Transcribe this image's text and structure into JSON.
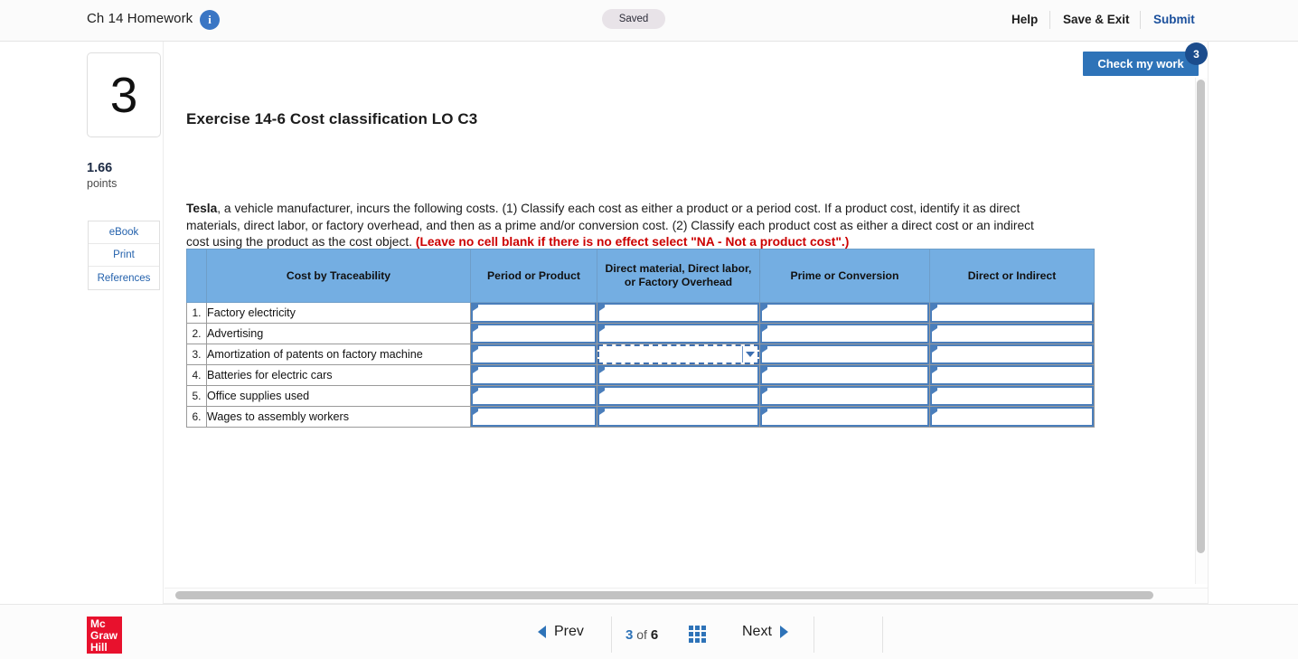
{
  "topbar": {
    "assignment_title": "Ch 14 Homework",
    "info_icon": "info-icon",
    "saved_status": "Saved",
    "help_label": "Help",
    "save_exit_label": "Save & Exit",
    "submit_label": "Submit"
  },
  "check_my_work": {
    "label": "Check my work",
    "badge_count": "3"
  },
  "rail": {
    "question_number": "3",
    "points_value": "1.66",
    "points_label": "points",
    "links": [
      {
        "label": "eBook"
      },
      {
        "label": "Print"
      },
      {
        "label": "References"
      }
    ]
  },
  "exercise": {
    "title": "Exercise 14-6 Cost classification LO C3",
    "prompt_bold_lead": "Tesla",
    "prompt_body": ", a vehicle manufacturer, incurs the following costs. (1) Classify each cost as either a product or a period cost. If a product cost, identify it as direct materials, direct labor, or factory overhead, and then as a prime and/or conversion cost. (2) Classify each product cost as either a direct cost or an indirect cost using the product as the cost object. ",
    "prompt_red": "(Leave no cell blank if there is no effect select \"NA - Not a product cost\".)"
  },
  "table": {
    "headers": [
      "Cost by Traceability",
      "Period or Product",
      "Direct material, Direct labor, or Factory Overhead",
      "Prime or Conversion",
      "Direct or Indirect"
    ],
    "rows": [
      {
        "num": "1.",
        "cost": "Factory electricity",
        "period_or_product": "",
        "dm_dl_fo": "",
        "prime_or_conversion": "",
        "direct_or_indirect": ""
      },
      {
        "num": "2.",
        "cost": "Advertising",
        "period_or_product": "",
        "dm_dl_fo": "",
        "prime_or_conversion": "",
        "direct_or_indirect": ""
      },
      {
        "num": "3.",
        "cost": "Amortization of patents on factory machine",
        "period_or_product": "",
        "dm_dl_fo": "",
        "prime_or_conversion": "",
        "direct_or_indirect": ""
      },
      {
        "num": "4.",
        "cost": "Batteries for electric cars",
        "period_or_product": "",
        "dm_dl_fo": "",
        "prime_or_conversion": "",
        "direct_or_indirect": ""
      },
      {
        "num": "5.",
        "cost": "Office supplies used",
        "period_or_product": "",
        "dm_dl_fo": "",
        "prime_or_conversion": "",
        "direct_or_indirect": ""
      },
      {
        "num": "6.",
        "cost": "Wages to assembly workers",
        "period_or_product": "",
        "dm_dl_fo": "",
        "prime_or_conversion": "",
        "direct_or_indirect": ""
      }
    ],
    "selected_cell": {
      "row": "3",
      "column": "Direct material, Direct labor, or Factory Overhead"
    }
  },
  "footer": {
    "logo_line1": "Mc",
    "logo_line2": "Graw",
    "logo_line3": "Hill",
    "prev_label": "Prev",
    "next_label": "Next",
    "page_current": "3",
    "page_of": "of",
    "page_total": "6"
  },
  "colors": {
    "accent_blue": "#2e73b8",
    "link_blue": "#2361ac",
    "submit_blue": "#1a4f9c",
    "header_fill": "#74aee2",
    "cell_border": "#4a7ebb",
    "red_text": "#cc0000",
    "logo_red": "#e8112d"
  }
}
